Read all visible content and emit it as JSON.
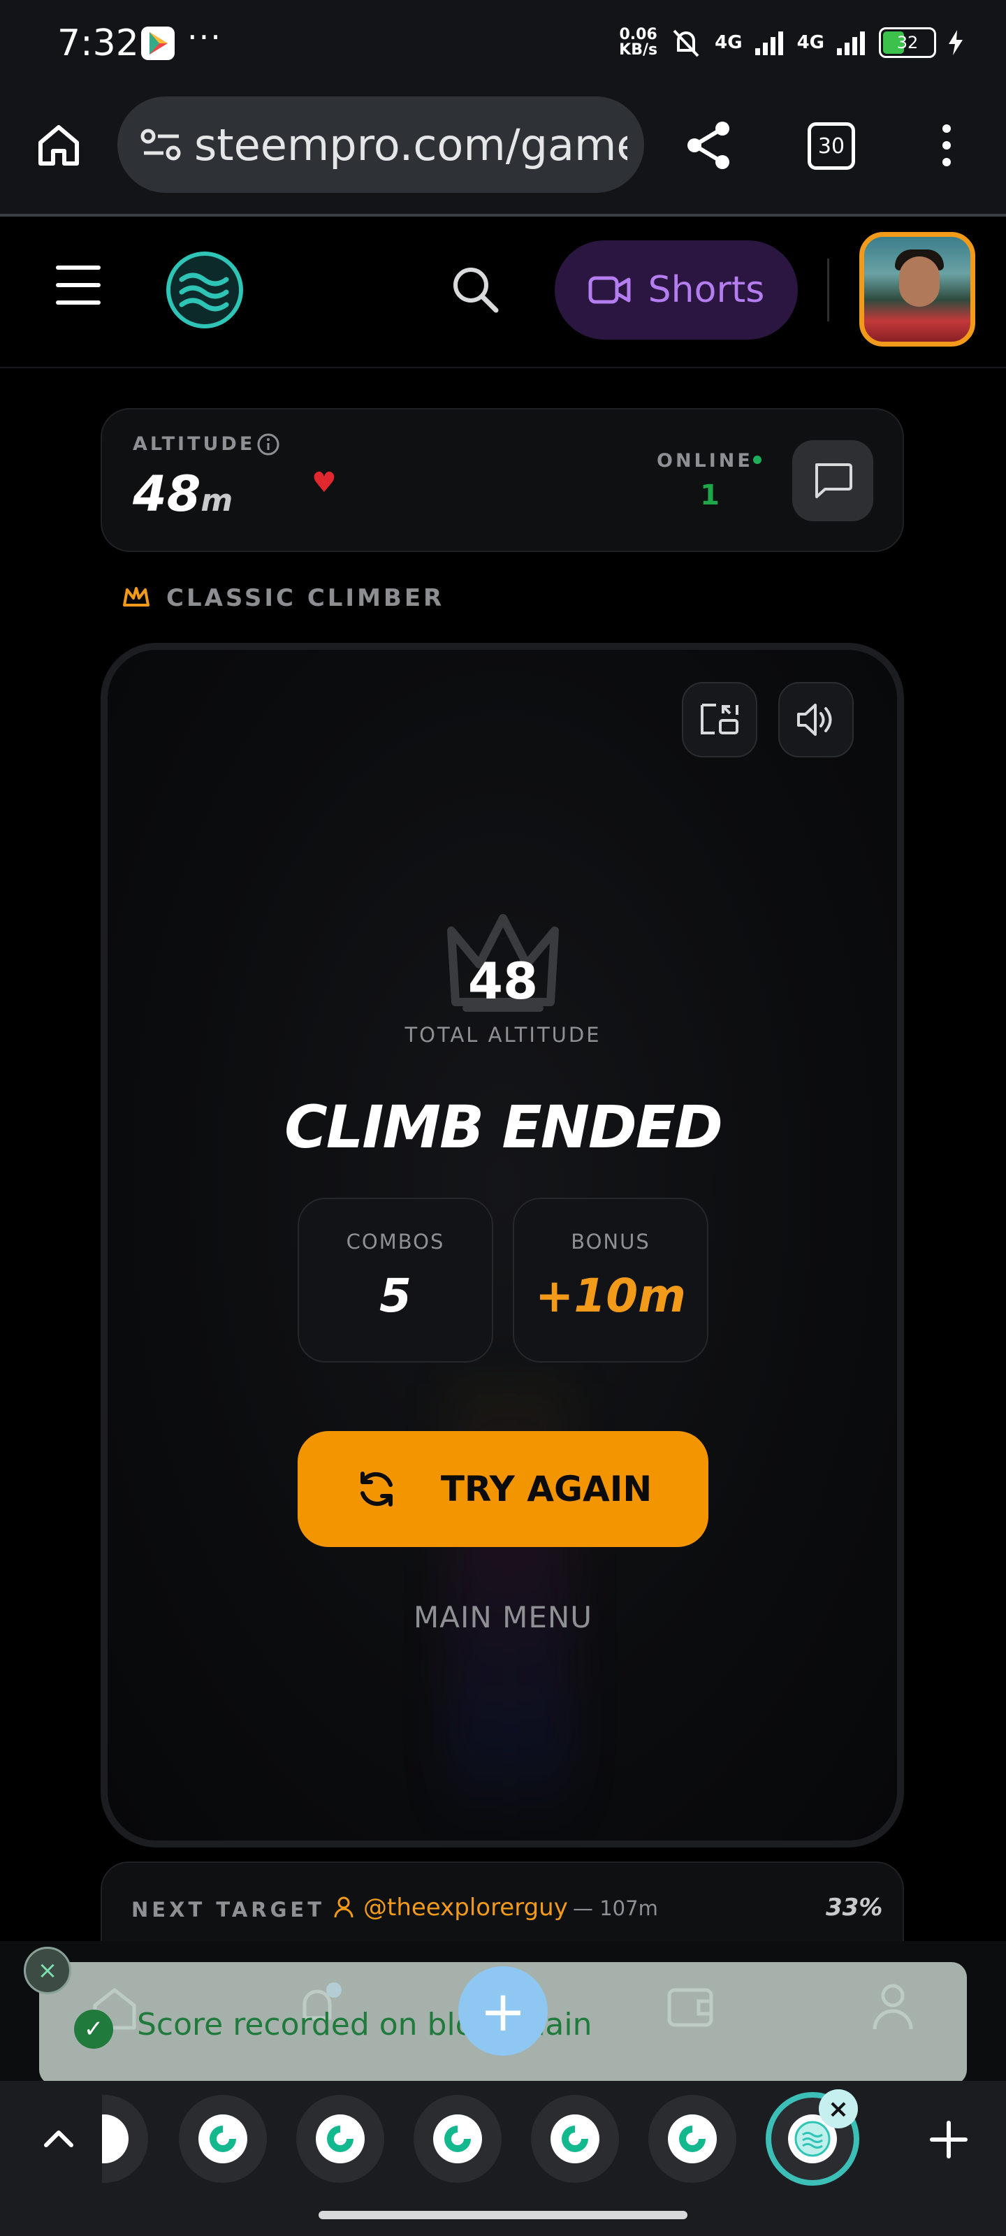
{
  "status_bar": {
    "time": "7:32",
    "more": "···",
    "net_speed_top": "0.06",
    "net_speed_bottom": "KB/s",
    "net1": "4G",
    "net2": "4G",
    "battery": "32"
  },
  "browser": {
    "url": "steempro.com/games",
    "tab_count": "30"
  },
  "header": {
    "shorts_label": "Shorts"
  },
  "altitude_card": {
    "label": "ALTITUDE",
    "value": "48",
    "unit": "m",
    "online_label": "ONLINE",
    "online_count": "1"
  },
  "mode": {
    "label": "CLASSIC CLIMBER"
  },
  "result": {
    "total_value": "48",
    "total_label": "TOTAL ALTITUDE",
    "title": "CLIMB ENDED",
    "combos_label": "COMBOS",
    "combos_value": "5",
    "bonus_label": "BONUS",
    "bonus_value": "+10m",
    "try_again": "TRY AGAIN",
    "main_menu": "MAIN MENU"
  },
  "next_target": {
    "label": "NEXT TARGET",
    "user": "@theexplorerguy",
    "distance": "— 107m",
    "percent": "33%"
  },
  "toast": {
    "message": "Score recorded on blockchain"
  },
  "colors": {
    "accent": "#f29500",
    "online": "#1fa64b",
    "brand_teal": "#2ec4b6",
    "shorts": "#b57ef0"
  }
}
